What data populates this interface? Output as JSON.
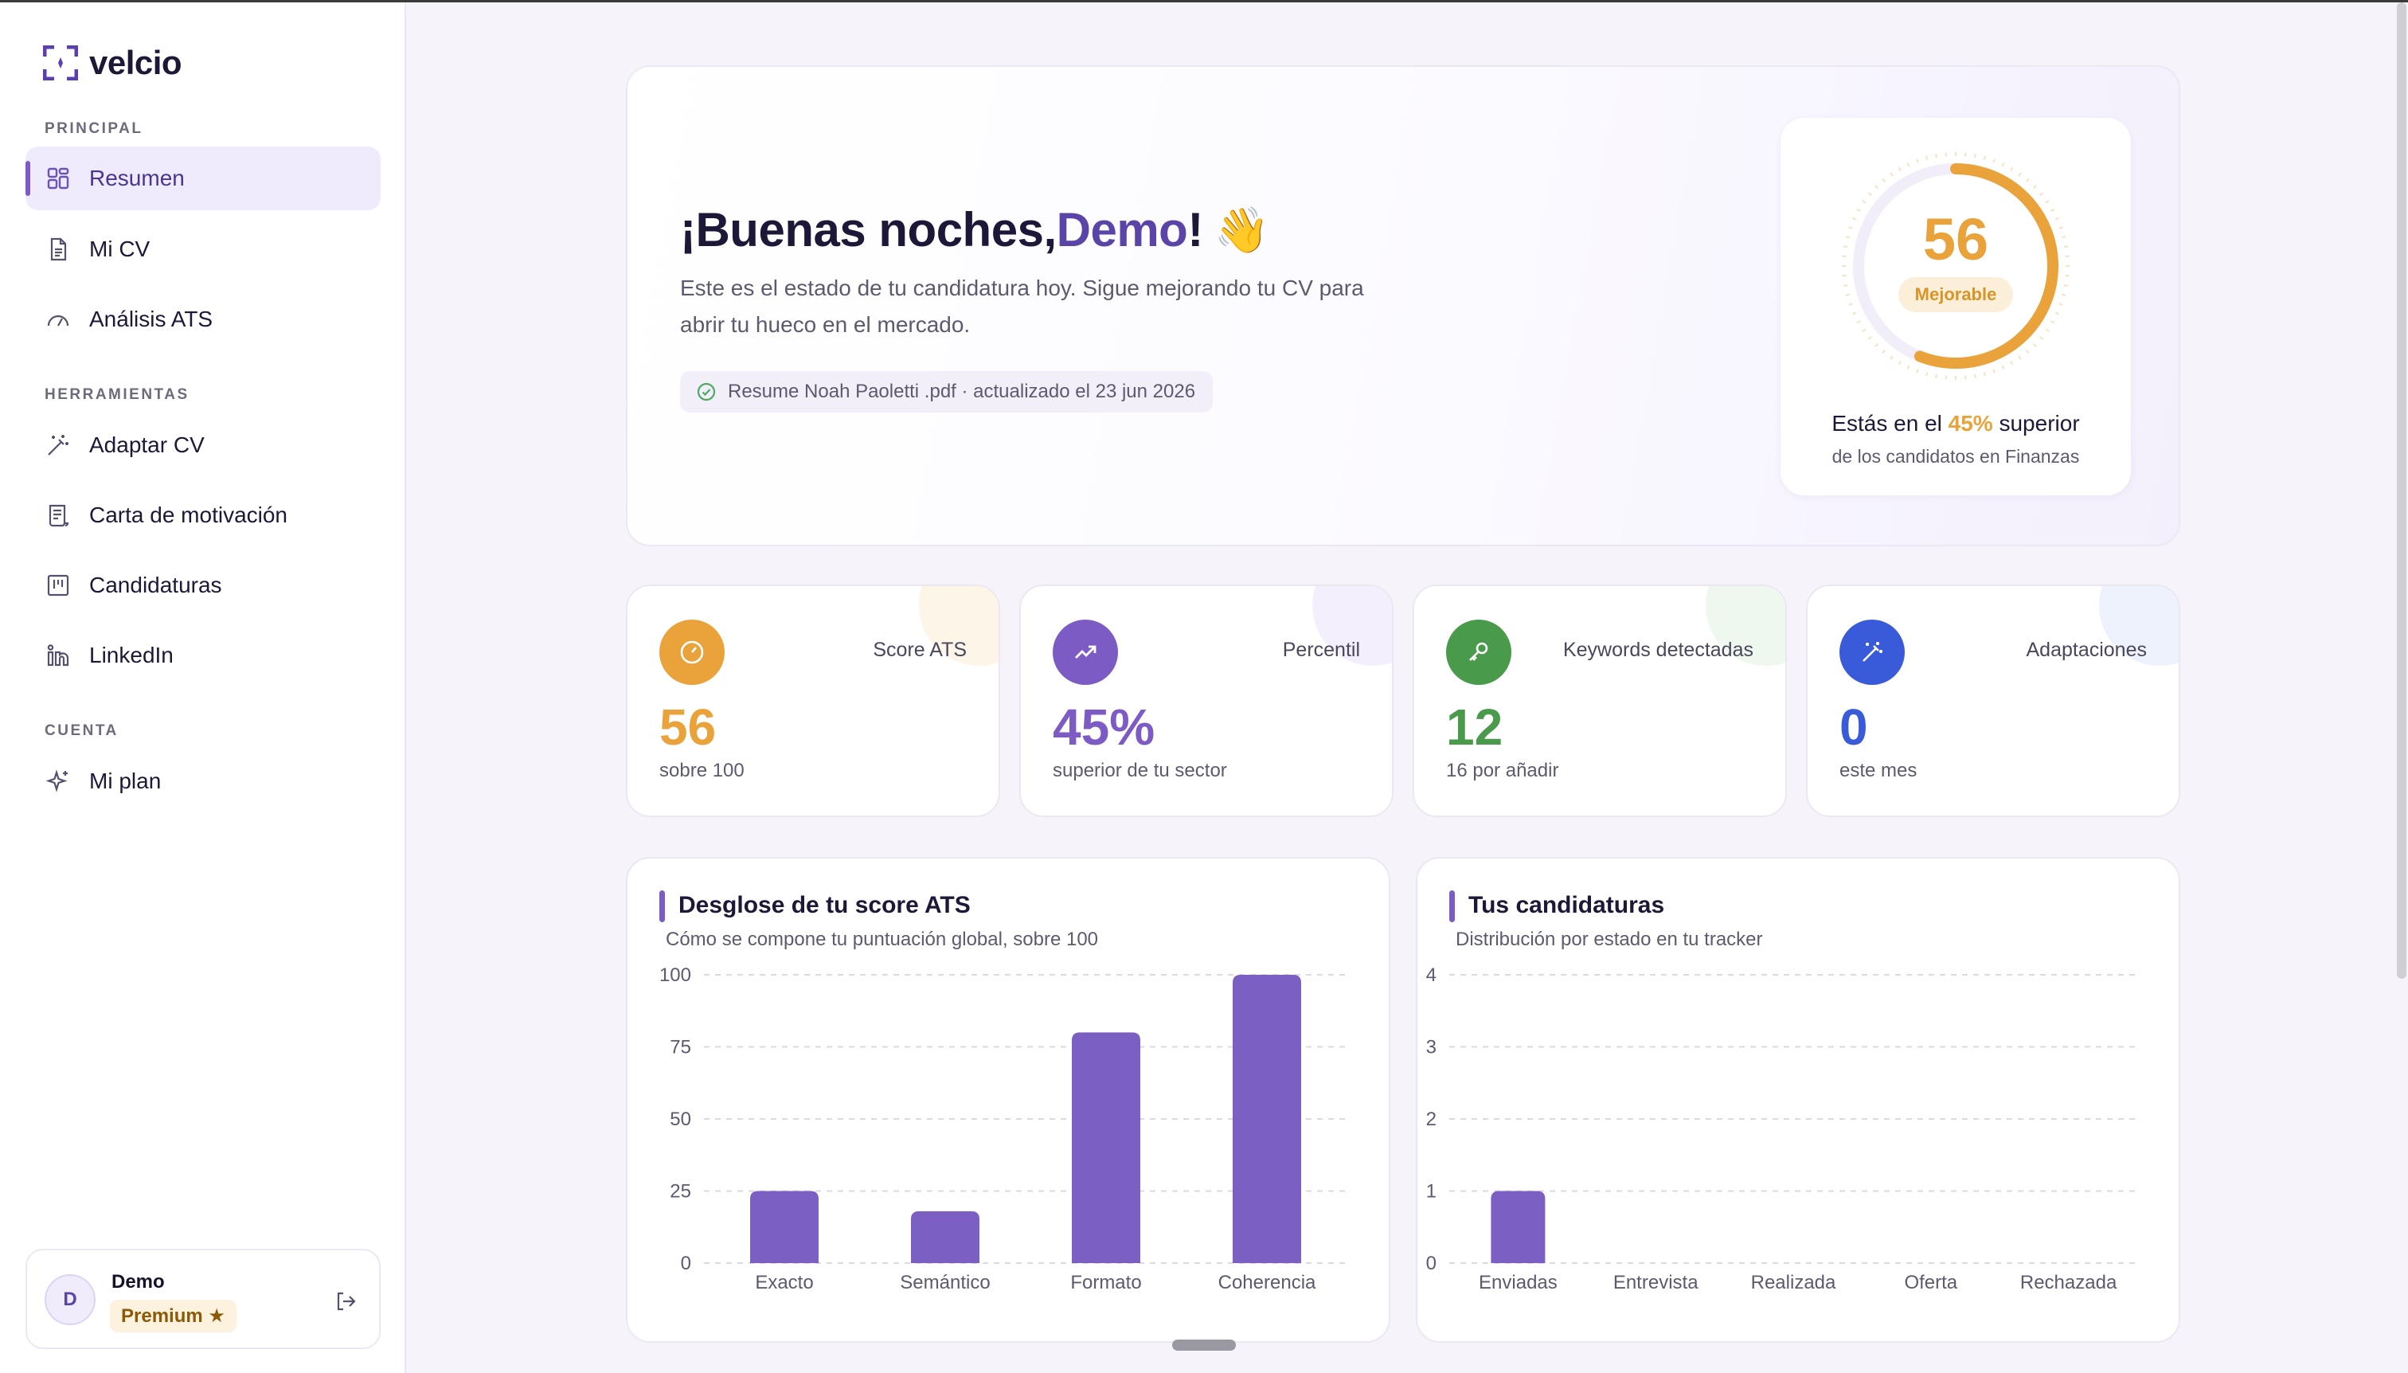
{
  "brand": {
    "name": "velcio"
  },
  "sidebar": {
    "sections": {
      "principal": "PRINCIPAL",
      "herramientas": "HERRAMIENTAS",
      "cuenta": "CUENTA"
    },
    "items": [
      {
        "label": "Resumen",
        "icon": "grid-icon",
        "active": true
      },
      {
        "label": "Mi CV",
        "icon": "document-icon"
      },
      {
        "label": "Análisis ATS",
        "icon": "gauge-icon"
      },
      {
        "label": "Adaptar CV",
        "icon": "magic-wand-icon"
      },
      {
        "label": "Carta de motivación",
        "icon": "scroll-icon"
      },
      {
        "label": "Candidaturas",
        "icon": "kanban-icon"
      },
      {
        "label": "LinkedIn",
        "icon": "linkedin-icon"
      },
      {
        "label": "Mi plan",
        "icon": "sparkles-icon"
      }
    ],
    "user": {
      "initial": "D",
      "name": "Demo",
      "plan": "Premium ★"
    }
  },
  "hero": {
    "greeting_prefix": "¡Buenas noches, ",
    "greeting_name": "Demo",
    "greeting_suffix": "!",
    "wave": "👋",
    "subtitle": "Este es el estado de tu candidatura hoy. Sigue mejorando tu CV para abrir tu hueco en el mercado.",
    "file_status": "Resume Noah Paoletti .pdf · actualizado el 23 jun 2026",
    "score": {
      "value": "56",
      "max": 100,
      "score_fraction": 0.56,
      "tag": "Mejorable",
      "line1_prefix": "Estás en el ",
      "line1_highlight": "45%",
      "line1_suffix": " superior",
      "line2": "de los candidatos en Finanzas"
    }
  },
  "stats": [
    {
      "label": "Score ATS",
      "value": "56",
      "note": "sobre 100",
      "color": "#e9a33a",
      "icon": "gauge-icon"
    },
    {
      "label": "Percentil",
      "value": "45%",
      "note": "superior de tu sector",
      "color": "#7c5cc4",
      "icon": "trending-up-icon"
    },
    {
      "label": "Keywords detectadas",
      "value": "12",
      "note": "16 por añadir",
      "color": "#4a9a4c",
      "icon": "key-icon"
    },
    {
      "label": "Adaptaciones",
      "value": "0",
      "note": "este mes",
      "color": "#3a5bd9",
      "icon": "magic-wand-icon"
    }
  ],
  "colors": {
    "accent": "#7c5cc4",
    "score": "#e9a33a",
    "bar": "#7c5fc2"
  },
  "chart_data": [
    {
      "type": "bar",
      "title": "Desglose de tu score ATS",
      "subtitle": "Cómo se compone tu puntuación global, sobre 100",
      "categories": [
        "Exacto",
        "Semántico",
        "Formato",
        "Coherencia"
      ],
      "values": [
        25,
        18,
        80,
        100
      ],
      "ylim": [
        0,
        100
      ],
      "yticks": [
        "0",
        "25",
        "50",
        "75",
        "100"
      ],
      "grid": true
    },
    {
      "type": "bar",
      "title": "Tus candidaturas",
      "subtitle": "Distribución por estado en tu tracker",
      "categories": [
        "Enviadas",
        "Entrevista",
        "Realizada",
        "Oferta",
        "Rechazada"
      ],
      "values": [
        1,
        0,
        0,
        0,
        0
      ],
      "ylim": [
        0,
        4
      ],
      "yticks": [
        "0",
        "1",
        "2",
        "3",
        "4"
      ],
      "grid": true
    }
  ]
}
